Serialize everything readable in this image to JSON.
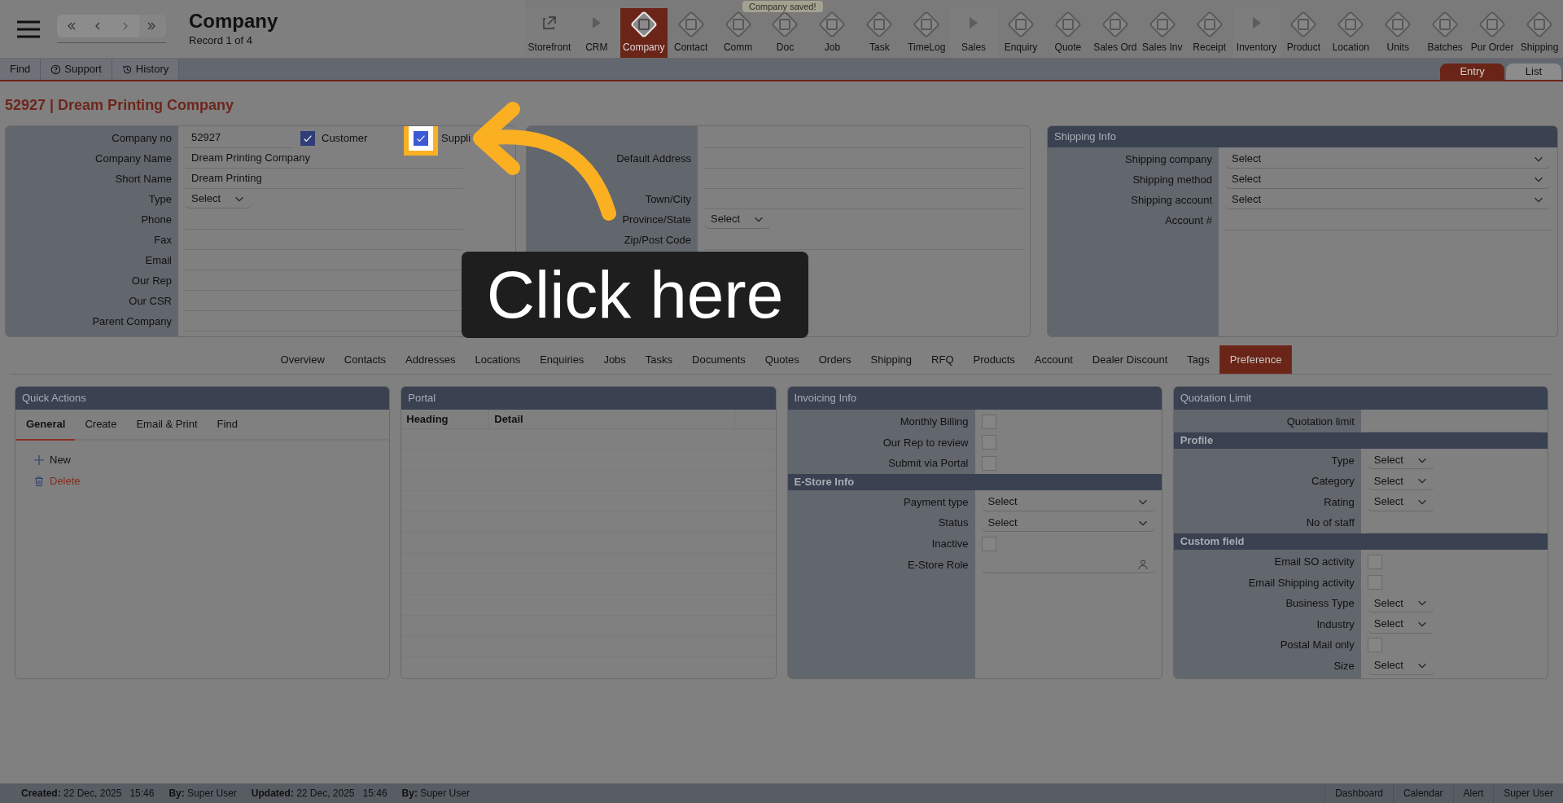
{
  "app": {
    "title": "Company",
    "record": "Record 1 of 4"
  },
  "toast": "Company saved!",
  "modules": [
    {
      "label": "Storefront",
      "kind": "link",
      "selected": false
    },
    {
      "label": "CRM",
      "kind": "group",
      "selected": false
    },
    {
      "label": "Company",
      "kind": "module",
      "selected": true
    },
    {
      "label": "Contact",
      "kind": "module",
      "selected": false
    },
    {
      "label": "Comm",
      "kind": "module",
      "selected": false
    },
    {
      "label": "Doc",
      "kind": "module",
      "selected": false
    },
    {
      "label": "Job",
      "kind": "module",
      "selected": false
    },
    {
      "label": "Task",
      "kind": "module",
      "selected": false
    },
    {
      "label": "TimeLog",
      "kind": "module",
      "selected": false
    },
    {
      "label": "Sales",
      "kind": "group",
      "selected": false
    },
    {
      "label": "Enquiry",
      "kind": "module",
      "selected": false
    },
    {
      "label": "Quote",
      "kind": "module",
      "selected": false
    },
    {
      "label": "Sales Ord",
      "kind": "module",
      "selected": false
    },
    {
      "label": "Sales Inv",
      "kind": "module",
      "selected": false
    },
    {
      "label": "Receipt",
      "kind": "module",
      "selected": false
    },
    {
      "label": "Inventory",
      "kind": "group",
      "selected": false
    },
    {
      "label": "Product",
      "kind": "module",
      "selected": false
    },
    {
      "label": "Location",
      "kind": "module",
      "selected": false
    },
    {
      "label": "Units",
      "kind": "module",
      "selected": false
    },
    {
      "label": "Batches",
      "kind": "module",
      "selected": false
    },
    {
      "label": "Pur Order",
      "kind": "module",
      "selected": false
    },
    {
      "label": "Shipping",
      "kind": "module",
      "selected": false
    }
  ],
  "toolbar": [
    {
      "label": "Find",
      "kind": "plain"
    },
    {
      "label": "Support",
      "kind": "help"
    },
    {
      "label": "History",
      "kind": "history"
    }
  ],
  "view_tabs": [
    {
      "label": "Entry",
      "selected": true
    },
    {
      "label": "List",
      "selected": false
    }
  ],
  "record_heading": "52927 | Dream Printing Company",
  "company_form": {
    "flags": [
      {
        "label": "Customer",
        "checked": true,
        "highlighted": false
      },
      {
        "label": "Suppli",
        "checked": true,
        "highlighted": true
      }
    ],
    "rows": [
      {
        "label": "Company no",
        "kind": "text",
        "value": "52927"
      },
      {
        "label": "Company Name",
        "kind": "text",
        "value": "Dream Printing Company"
      },
      {
        "label": "Short Name",
        "kind": "text",
        "value": "Dream Printing"
      },
      {
        "label": "Type",
        "kind": "select",
        "value": "Select"
      },
      {
        "label": "Phone",
        "kind": "text"
      },
      {
        "label": "Fax",
        "kind": "text"
      },
      {
        "label": "Email",
        "kind": "text"
      },
      {
        "label": "Our Rep",
        "kind": "text"
      },
      {
        "label": "Our CSR",
        "kind": "text"
      },
      {
        "label": "Parent Company",
        "kind": "text"
      }
    ]
  },
  "address_form": {
    "rows": [
      {
        "label": "Default Address",
        "kind": "textarea"
      },
      {
        "label": "Town/City",
        "kind": "text"
      },
      {
        "label": "Province/State",
        "kind": "select",
        "value": "Select"
      },
      {
        "label": "Zip/Post Code",
        "kind": "text"
      }
    ]
  },
  "shipping_info": {
    "title": "Shipping Info",
    "rows": [
      {
        "label": "Shipping company",
        "kind": "select",
        "value": "Select"
      },
      {
        "label": "Shipping method",
        "kind": "select",
        "value": "Select"
      },
      {
        "label": "Shipping account",
        "kind": "select",
        "value": "Select"
      },
      {
        "label": "Account #",
        "kind": "text"
      }
    ]
  },
  "section_tabs": [
    {
      "label": "Overview",
      "selected": false
    },
    {
      "label": "Contacts",
      "selected": false
    },
    {
      "label": "Addresses",
      "selected": false
    },
    {
      "label": "Locations",
      "selected": false
    },
    {
      "label": "Enquiries",
      "selected": false
    },
    {
      "label": "Jobs",
      "selected": false
    },
    {
      "label": "Tasks",
      "selected": false
    },
    {
      "label": "Documents",
      "selected": false
    },
    {
      "label": "Quotes",
      "selected": false
    },
    {
      "label": "Orders",
      "selected": false
    },
    {
      "label": "Shipping",
      "selected": false
    },
    {
      "label": "RFQ",
      "selected": false
    },
    {
      "label": "Products",
      "selected": false
    },
    {
      "label": "Account",
      "selected": false
    },
    {
      "label": "Dealer Discount",
      "selected": false
    },
    {
      "label": "Tags",
      "selected": false
    },
    {
      "label": "Preference",
      "selected": true
    }
  ],
  "quick_actions": {
    "title": "Quick Actions",
    "tabs": [
      {
        "label": "General",
        "selected": true
      },
      {
        "label": "Create",
        "selected": false
      },
      {
        "label": "Email & Print",
        "selected": false
      },
      {
        "label": "Find",
        "selected": false
      }
    ],
    "actions": [
      {
        "label": "New",
        "kind": "create"
      },
      {
        "label": "Delete",
        "kind": "delete"
      }
    ]
  },
  "portal": {
    "title": "Portal",
    "columns": [
      "Heading",
      "Detail"
    ]
  },
  "invoicing_info": {
    "title": "Invoicing Info",
    "sections": [
      {
        "rows": [
          {
            "label": "Monthly Billing",
            "kind": "checkbox",
            "checked": false
          },
          {
            "label": "Our Rep to review",
            "kind": "checkbox",
            "checked": false
          },
          {
            "label": "Submit via Portal",
            "kind": "checkbox",
            "checked": false
          }
        ]
      },
      {
        "heading": "E-Store Info",
        "rows": [
          {
            "label": "Payment type",
            "kind": "select",
            "value": "Select"
          },
          {
            "label": "Status",
            "kind": "select",
            "value": "Select"
          },
          {
            "label": "Inactive",
            "kind": "checkbox",
            "checked": false
          },
          {
            "label": "E-Store Role",
            "kind": "lookup"
          }
        ]
      }
    ]
  },
  "quotation_limit": {
    "title": "Quotation Limit",
    "sections": [
      {
        "rows": [
          {
            "label": "Quotation limit",
            "kind": "text"
          }
        ]
      },
      {
        "heading": "Profile",
        "rows": [
          {
            "label": "Type",
            "kind": "select",
            "value": "Select"
          },
          {
            "label": "Category",
            "kind": "select",
            "value": "Select"
          },
          {
            "label": "Rating",
            "kind": "select",
            "value": "Select"
          },
          {
            "label": "No of staff",
            "kind": "text"
          }
        ]
      },
      {
        "heading": "Custom field",
        "rows": [
          {
            "label": "Email SO activity",
            "kind": "checkbox",
            "checked": false
          },
          {
            "label": "Email Shipping activity",
            "kind": "checkbox",
            "checked": false
          },
          {
            "label": "Business Type",
            "kind": "select",
            "value": "Select"
          },
          {
            "label": "Industry",
            "kind": "select",
            "value": "Select"
          },
          {
            "label": "Postal Mail only",
            "kind": "checkbox",
            "checked": false
          },
          {
            "label": "Size",
            "kind": "select",
            "value": "Select"
          }
        ]
      }
    ]
  },
  "footer": {
    "info": [
      "**Created:** 22 Dec, 2025",
      "15:46",
      "**By:** Super User",
      "**Updated:** 22 Dec, 2025",
      "15:46",
      "**By:** Super User"
    ],
    "links": [
      "Dashboard",
      "Calendar",
      "Alert",
      "Super User"
    ]
  },
  "callout": {
    "text": "Click here"
  }
}
